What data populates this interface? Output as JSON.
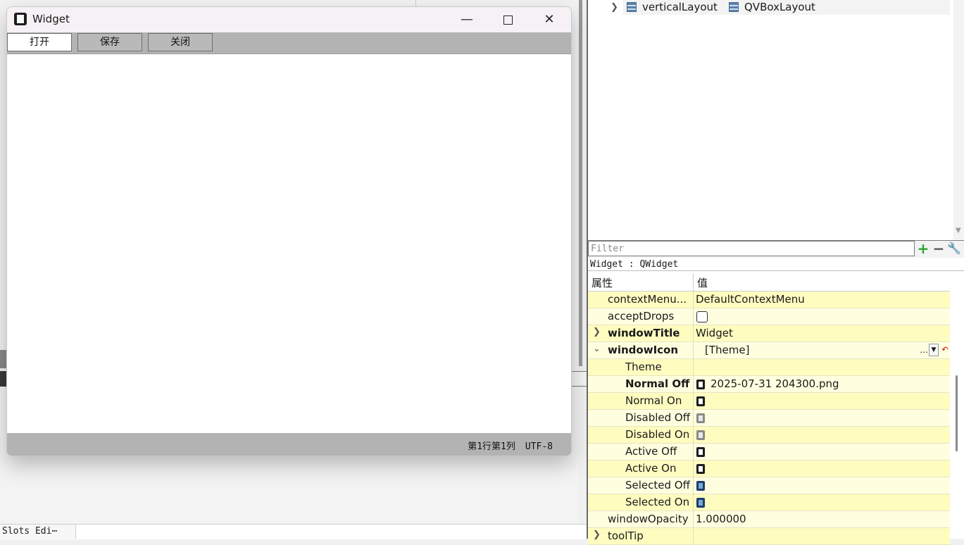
{
  "window": {
    "title": "Widget",
    "buttons": [
      "打开",
      "保存",
      "关闭"
    ],
    "status_position": "第1行第1列",
    "status_encoding": "UTF-8"
  },
  "bottom_tab": "Slots Edi⋯",
  "object_tree": {
    "row": {
      "name": "verticalLayout",
      "class": "QVBoxLayout"
    }
  },
  "filter": {
    "placeholder": "Filter"
  },
  "object_label": "Widget : QWidget",
  "property_editor": {
    "headers": [
      "属性",
      "值"
    ],
    "rows": [
      {
        "name": "contextMenu...",
        "value": "DefaultContextMenu"
      },
      {
        "name": "acceptDrops",
        "value": ""
      },
      {
        "name": "windowTitle",
        "value": "Widget"
      },
      {
        "name": "windowIcon",
        "value": "[Theme]"
      },
      {
        "name": "Theme",
        "value": ""
      },
      {
        "name": "Normal Off",
        "value": "2025-07-31 204300.png"
      },
      {
        "name": "Normal On",
        "value": ""
      },
      {
        "name": "Disabled Off",
        "value": ""
      },
      {
        "name": "Disabled On",
        "value": ""
      },
      {
        "name": "Active Off",
        "value": ""
      },
      {
        "name": "Active On",
        "value": ""
      },
      {
        "name": "Selected Off",
        "value": ""
      },
      {
        "name": "Selected On",
        "value": ""
      },
      {
        "name": "windowOpacity",
        "value": "1.000000"
      },
      {
        "name": "toolTip",
        "value": ""
      }
    ]
  },
  "icons": {
    "app": "app-window-icon",
    "layout": "vertical-layout-icon",
    "filter_add": "plus-icon",
    "filter_remove": "minus-icon",
    "filter_config": "wrench-icon"
  }
}
